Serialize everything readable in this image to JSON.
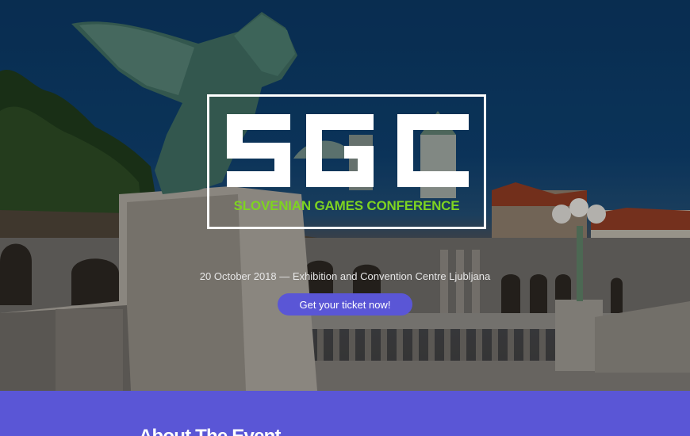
{
  "hero": {
    "logo_text": "SGC",
    "logo_subtitle": "SLOVENIAN GAMES CONFERENCE",
    "event_meta": "20 October 2018 — Exhibition and Convention Centre Ljubljana",
    "cta_label": "Get your ticket now!"
  },
  "about": {
    "title": "About The Event"
  },
  "colors": {
    "accent": "#5a56d6",
    "logo_subtitle": "#7ed321",
    "sky": "#0b3762"
  }
}
